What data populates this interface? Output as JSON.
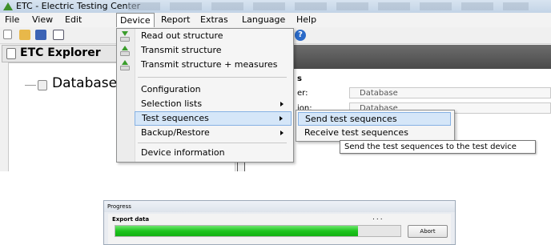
{
  "window": {
    "title": "ETC - Electric Testing Center"
  },
  "menubar": {
    "items": [
      "File",
      "View",
      "Edit",
      "Device",
      "Report",
      "Extras",
      "Language",
      "Help"
    ]
  },
  "toolbar": {
    "icons": [
      "new-icon",
      "open-icon",
      "save-icon",
      "mail-icon",
      "help-icon"
    ],
    "help_glyph": "?"
  },
  "explorer": {
    "title": "ETC Explorer",
    "root_node": "Database"
  },
  "details": {
    "label_1": "s",
    "label_2": "er:",
    "value_2": "Database",
    "label_3": "ion:",
    "value_3": "Database"
  },
  "device_menu": {
    "items": [
      {
        "label": "Read out structure",
        "icon": "download-icon"
      },
      {
        "label": "Transmit structure",
        "icon": "upload-icon"
      },
      {
        "label": "Transmit structure + measures",
        "icon": "upload-measures-icon"
      },
      {
        "label": "Configuration"
      },
      {
        "label": "Selection lists",
        "submenu": true
      },
      {
        "label": "Test sequences",
        "submenu": true,
        "highlighted": true
      },
      {
        "label": "Backup/Restore",
        "submenu": true
      },
      {
        "label": "Device information"
      }
    ]
  },
  "test_sequences_submenu": {
    "items": [
      "Send test sequences",
      "Receive test sequences"
    ],
    "highlighted": "Send test sequences"
  },
  "tooltip": {
    "text": "Send the test sequences to the test device"
  },
  "progress_dialog": {
    "title": "Progress",
    "label": "Export data",
    "dots": "...",
    "progress": 0.85,
    "abort_label": "Abort"
  },
  "colors": {
    "highlight": "#d5e6f8",
    "progress_green": "#1ec51e"
  }
}
